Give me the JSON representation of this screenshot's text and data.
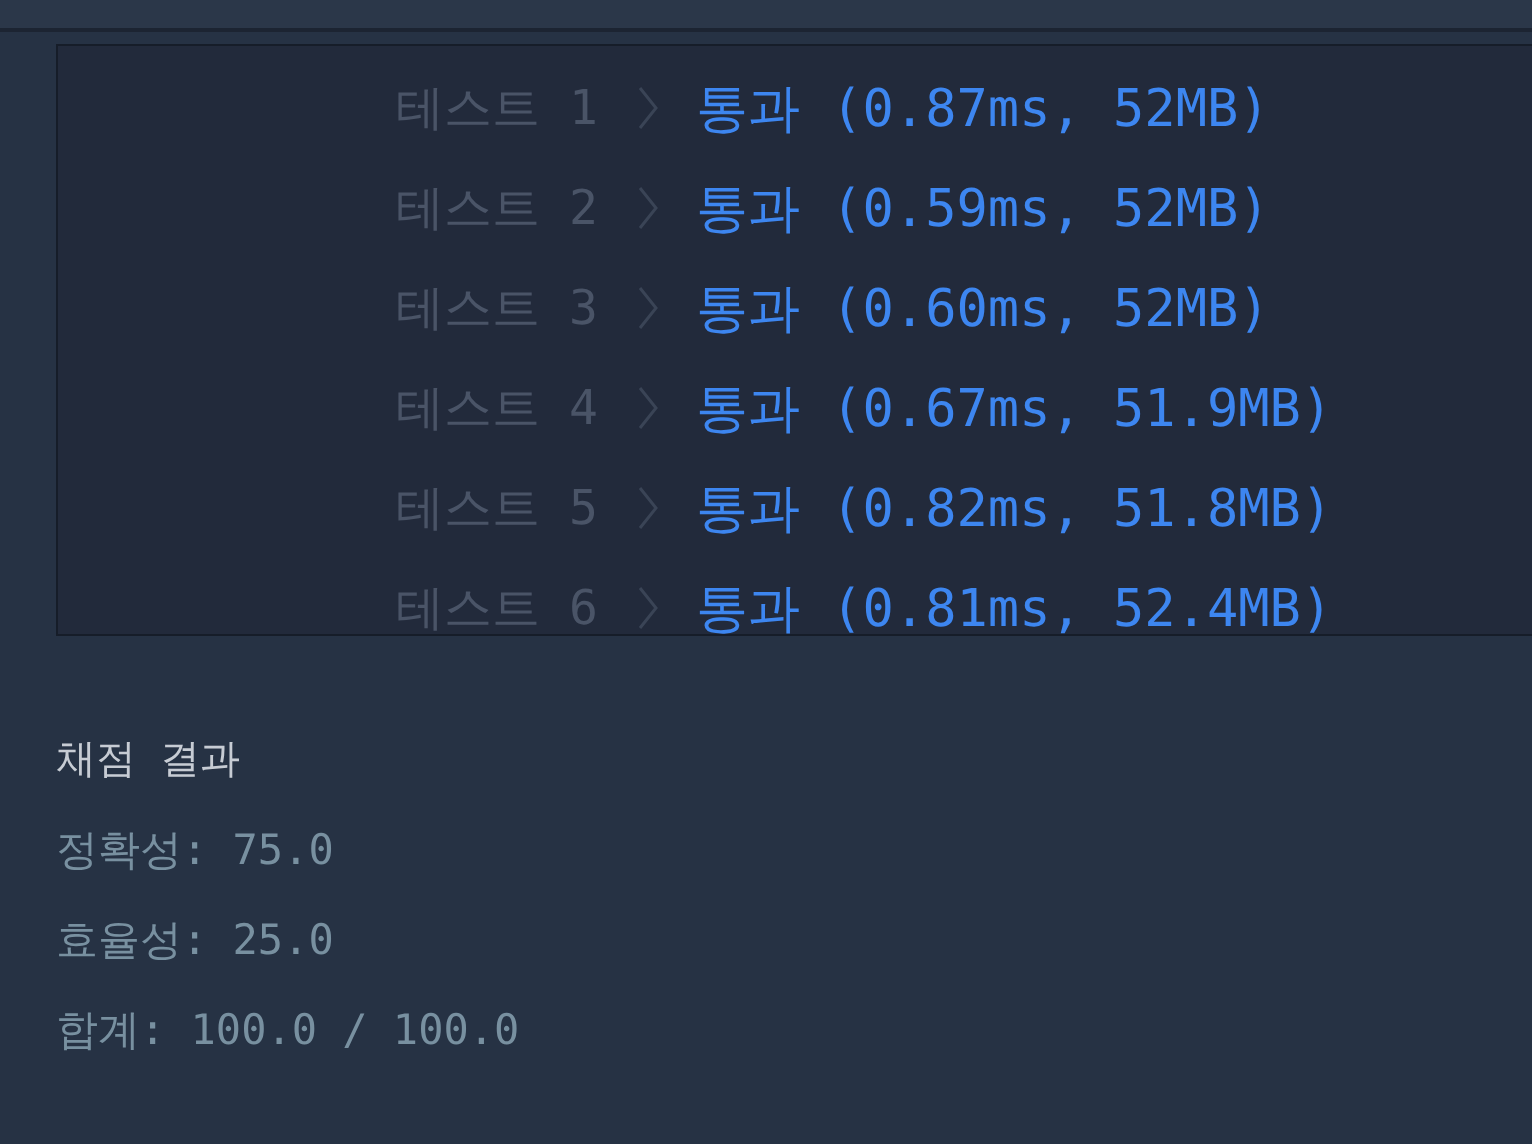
{
  "tests": [
    {
      "label": "테스트 1",
      "result": "통과 (0.87ms, 52MB)"
    },
    {
      "label": "테스트 2",
      "result": "통과 (0.59ms, 52MB)"
    },
    {
      "label": "테스트 3",
      "result": "통과 (0.60ms, 52MB)"
    },
    {
      "label": "테스트 4",
      "result": "통과 (0.67ms, 51.9MB)"
    },
    {
      "label": "테스트 5",
      "result": "통과 (0.82ms, 51.8MB)"
    },
    {
      "label": "테스트 6",
      "result": "통과 (0.81ms, 52.4MB)"
    }
  ],
  "summary": {
    "title": "채점 결과",
    "lines": [
      "정확성: 75.0",
      "효율성: 25.0",
      "합계: 100.0 / 100.0"
    ]
  }
}
